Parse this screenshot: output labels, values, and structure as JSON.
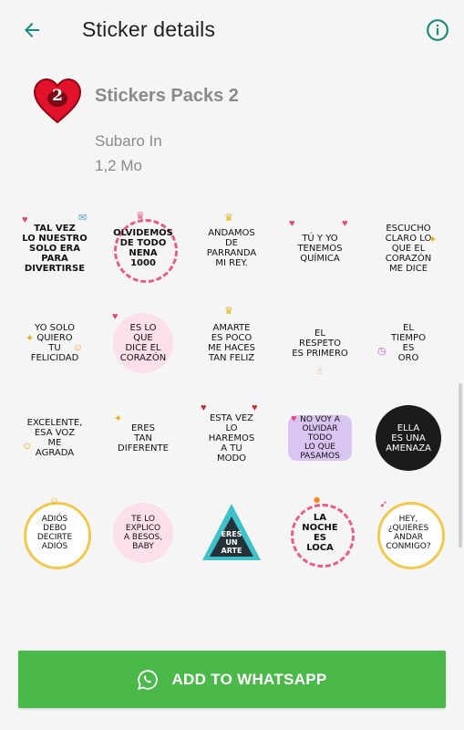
{
  "appbar": {
    "title": "Sticker details",
    "back_icon": "arrow-left-icon",
    "info_icon": "info-icon",
    "accent_color": "#1a8a7a"
  },
  "pack": {
    "name": "Stickers Packs 2",
    "author": "Subaro In",
    "size": "1,2 Mo",
    "icon": "red-heart-2-icon",
    "icon_number": "2"
  },
  "stickers": [
    {
      "text": "TAL VEZ\nLO NUESTRO\nSOLO ERA\nPARA\nDIVERTIRSE"
    },
    {
      "text": "OLVIDEMOS\nDE TODO\nNENA\n1000"
    },
    {
      "text": "ANDAMOS\nDE\nPARRANDA\nMI REY."
    },
    {
      "text": "TÚ Y YO\nTENEMOS\nQUÍMICA"
    },
    {
      "text": "ESCUCHO\nCLARO LO\nQUE EL\nCORAZÓN\nME DICE"
    },
    {
      "text": "YO SOLO\nQUIERO\nTU\nFELICIDAD"
    },
    {
      "text": "ES LO\nQUE\nDICE EL\nCORAZÓN"
    },
    {
      "text": "AMARTE\nES POCO\nME HACES\nTAN FELIZ"
    },
    {
      "text": "EL\nRESPETO\nES PRIMERO"
    },
    {
      "text": "EL\nTIEMPO\nES\nORO"
    },
    {
      "text": "EXCELENTE,\nESA VOZ\nME\nAGRADA"
    },
    {
      "text": "ERES\nTAN\nDIFERENTE"
    },
    {
      "text": "ESTA VEZ\nLO\nHAREMOS\nA TU\nMODO"
    },
    {
      "text": "NO VOY A\nOLVIDAR\nTODO\nLO QUE\nPASAMOS"
    },
    {
      "text": "ELLA\nES UNA\nAMENAZA"
    },
    {
      "text": "ADIÓS\nDEBO\nDECIRTE\nADIÓS"
    },
    {
      "text": "TE LO\nEXPLICO\nA BESOS,\nBABY"
    },
    {
      "text": "ERES\nUN\nARTE"
    },
    {
      "text": "LA\nNOCHE\nES\nLOCA"
    },
    {
      "text": "HEY,\n¿QUIERES\nANDAR\nCONMIGO?"
    }
  ],
  "action": {
    "label": "ADD TO WHATSAPP",
    "icon": "whatsapp-icon",
    "color": "#4bb84a"
  }
}
